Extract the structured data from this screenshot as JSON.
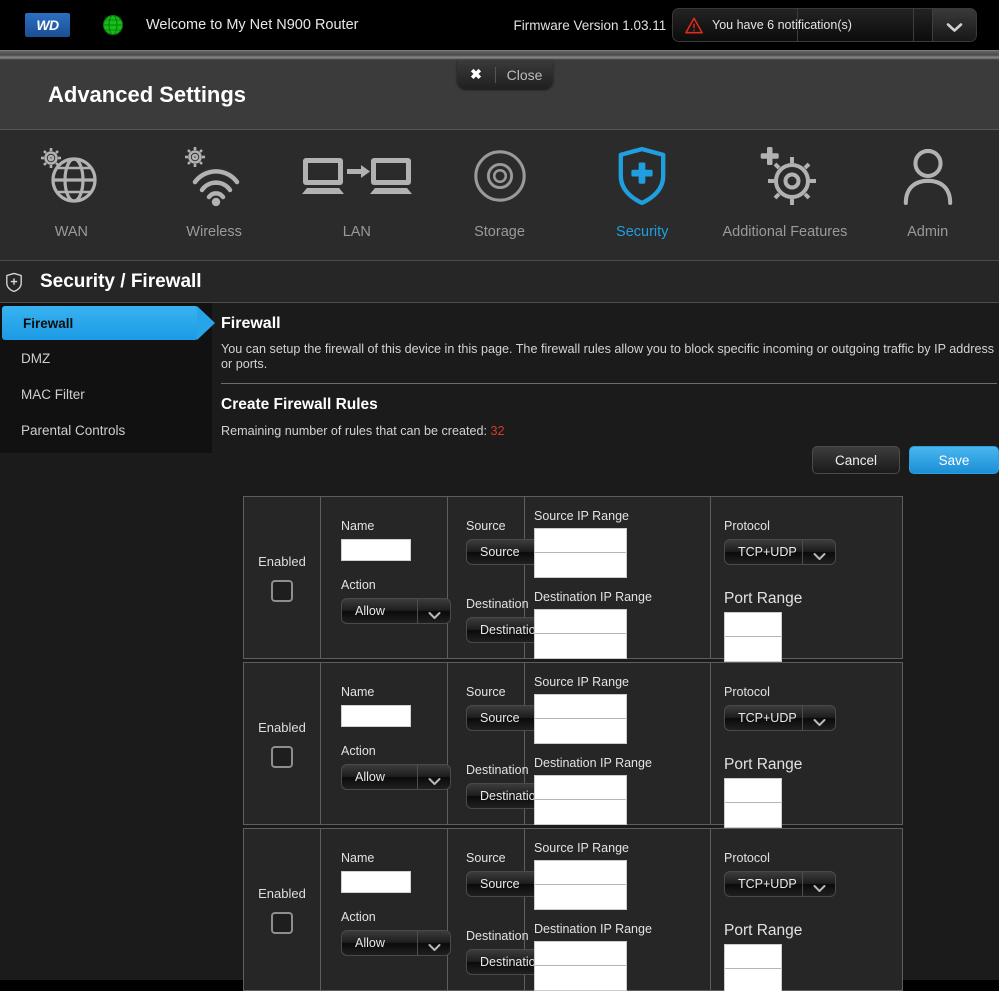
{
  "header": {
    "logo_text": "WD",
    "globe_icon": "globe-icon",
    "welcome": "Welcome to My Net N900 Router",
    "firmware": "Firmware Version 1.03.11",
    "notification": {
      "warning_icon": "warning-triangle-icon",
      "text": "You have 6 notification(s)",
      "expand_icon": "chevron-down-icon"
    }
  },
  "banner": {
    "title": "Advanced Settings",
    "close_x": "✖",
    "close_label": "Close"
  },
  "nav": {
    "items": [
      {
        "label": "WAN",
        "icon": "wan-globe-gear-icon",
        "active": false
      },
      {
        "label": "Wireless",
        "icon": "wireless-gear-icon",
        "active": false
      },
      {
        "label": "LAN",
        "icon": "lan-computers-icon",
        "active": false
      },
      {
        "label": "Storage",
        "icon": "storage-disc-icon",
        "active": false
      },
      {
        "label": "Security",
        "icon": "security-shield-icon",
        "active": true
      },
      {
        "label": "Additional Features",
        "icon": "gear-plus-icon",
        "active": false
      },
      {
        "label": "Admin",
        "icon": "admin-person-icon",
        "active": false
      }
    ]
  },
  "breadcrumb": {
    "icon": "shield-plus-icon",
    "text": "Security / Firewall"
  },
  "sidebar": {
    "items": [
      {
        "label": "Firewall",
        "active": true
      },
      {
        "label": "DMZ",
        "active": false
      },
      {
        "label": "MAC Filter",
        "active": false
      },
      {
        "label": "Parental Controls",
        "active": false
      }
    ]
  },
  "main": {
    "section_title": "Firewall",
    "description": "You can setup the firewall of this device in this page. The firewall rules allow you to block specific incoming or outgoing traffic by IP address or ports.",
    "create_title": "Create Firewall Rules",
    "remaining_label": "Remaining number of rules that can be created:",
    "remaining_count": "32",
    "cancel_label": "Cancel",
    "save_label": "Save",
    "labels": {
      "enabled": "Enabled",
      "name": "Name",
      "action": "Action",
      "source": "Source",
      "destination": "Destination",
      "source_ip_range": "Source IP Range",
      "destination_ip_range": "Destination IP Range",
      "protocol": "Protocol",
      "port_range": "Port Range"
    },
    "rules": [
      {
        "enabled": false,
        "name": "",
        "action": "Allow",
        "source": "Source",
        "destination": "Destination",
        "source_ip_from": "",
        "source_ip_to": "",
        "dest_ip_from": "",
        "dest_ip_to": "",
        "protocol": "TCP+UDP",
        "port_from": "",
        "port_to": ""
      },
      {
        "enabled": false,
        "name": "",
        "action": "Allow",
        "source": "Source",
        "destination": "Destination",
        "source_ip_from": "",
        "source_ip_to": "",
        "dest_ip_from": "",
        "dest_ip_to": "",
        "protocol": "TCP+UDP",
        "port_from": "",
        "port_to": ""
      },
      {
        "enabled": false,
        "name": "",
        "action": "Allow",
        "source": "Source",
        "destination": "Destination",
        "source_ip_from": "",
        "source_ip_to": "",
        "dest_ip_from": "",
        "dest_ip_to": "",
        "protocol": "TCP+UDP",
        "port_from": "",
        "port_to": ""
      }
    ]
  },
  "colors": {
    "accent_blue": "#1f9fe0",
    "sidebar_active": "#26a6e8",
    "save_blue": "#2f9ede",
    "warning_red": "#d63b2a",
    "count_red": "#d63b2a"
  }
}
